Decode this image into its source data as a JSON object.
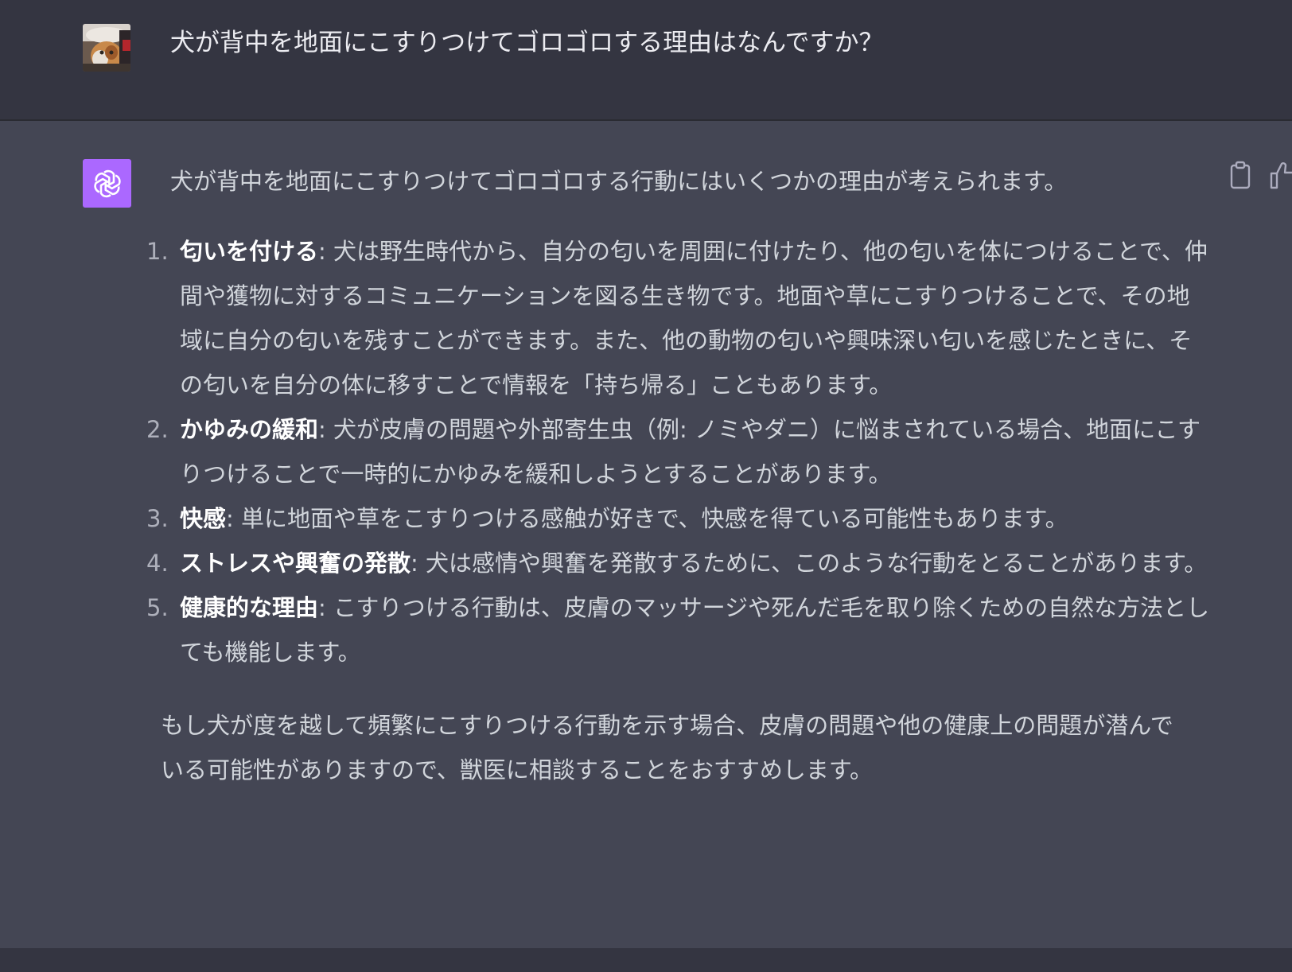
{
  "user": {
    "question": "犬が背中を地面にこすりつけてゴロゴロする理由はなんですか？"
  },
  "assistant": {
    "intro": "犬が背中を地面にこすりつけてゴロゴロする行動にはいくつかの理由が考えられます。",
    "reasons": [
      {
        "number": "1.",
        "title": "匂いを付ける",
        "text": ": 犬は野生時代から、自分の匂いを周囲に付けたり、他の匂いを体につけることで、仲間や獲物に対するコミュニケーションを図る生き物です。地面や草にこすりつけることで、その地域に自分の匂いを残すことができます。また、他の動物の匂いや興味深い匂いを感じたときに、その匂いを自分の体に移すことで情報を「持ち帰る」こともあります。"
      },
      {
        "number": "2.",
        "title": "かゆみの緩和",
        "text": ": 犬が皮膚の問題や外部寄生虫（例: ノミやダニ）に悩まされている場合、地面にこすりつけることで一時的にかゆみを緩和しようとすることがあります。"
      },
      {
        "number": "3.",
        "title": "快感",
        "text": ": 単に地面や草をこすりつける感触が好きで、快感を得ている可能性もあります。"
      },
      {
        "number": "4.",
        "title": "ストレスや興奮の発散",
        "text": ": 犬は感情や興奮を発散するために、このような行動をとることがあります。"
      },
      {
        "number": "5.",
        "title": "健康的な理由",
        "text": ": こすりつける行動は、皮膚のマッサージや死んだ毛を取り除くための自然な方法としても機能します。"
      }
    ],
    "closing": "もし犬が度を越して頻繁にこすりつける行動を示す場合、皮膚の問題や他の健康上の問題が潜んでいる可能性がありますので、獣医に相談することをおすすめします。"
  },
  "icons": {
    "user_avatar": "cat-photo-avatar",
    "assistant_avatar": "openai-logo-icon",
    "copy": "clipboard-icon",
    "feedback": "thumbs-up-icon"
  },
  "colors": {
    "user_bg": "#343541",
    "assistant_bg": "#444654",
    "assistant_avatar_bg": "#ab68ff"
  }
}
